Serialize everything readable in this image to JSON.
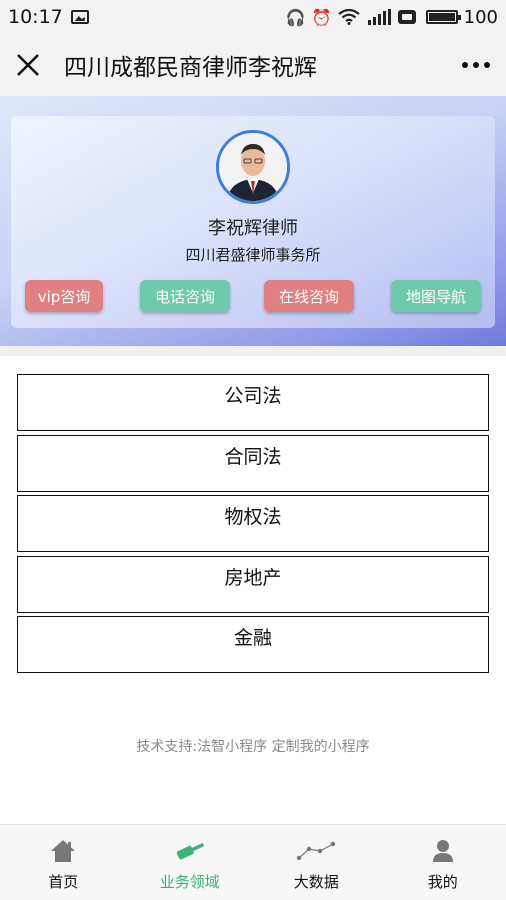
{
  "status_bar": {
    "time": "10:17",
    "battery": "100"
  },
  "title_bar": {
    "title": "四川成都民商律师李祝辉"
  },
  "profile": {
    "name": "李祝辉律师",
    "firm": "四川君盛律师事务所",
    "buttons": {
      "vip": "vip咨询",
      "phone": "电话咨询",
      "online": "在线咨询",
      "map": "地图导航"
    }
  },
  "practice_areas": [
    {
      "label": "公司法"
    },
    {
      "label": "合同法"
    },
    {
      "label": "物权法"
    },
    {
      "label": "房地产"
    },
    {
      "label": "金融"
    }
  ],
  "footer": {
    "support_text": "技术支持:法智小程序 定制我的小程序"
  },
  "bottom_nav": {
    "items": [
      {
        "label": "首页",
        "icon": "home-icon"
      },
      {
        "label": "业务领域",
        "icon": "gavel-icon",
        "active": true
      },
      {
        "label": "大数据",
        "icon": "line-chart-icon"
      },
      {
        "label": "我的",
        "icon": "user-icon"
      }
    ]
  },
  "colors": {
    "accent_green": "#3bb37a",
    "button_red": "#e08080",
    "button_teal": "#6fc9ad",
    "avatar_border": "#3d7fd1"
  }
}
